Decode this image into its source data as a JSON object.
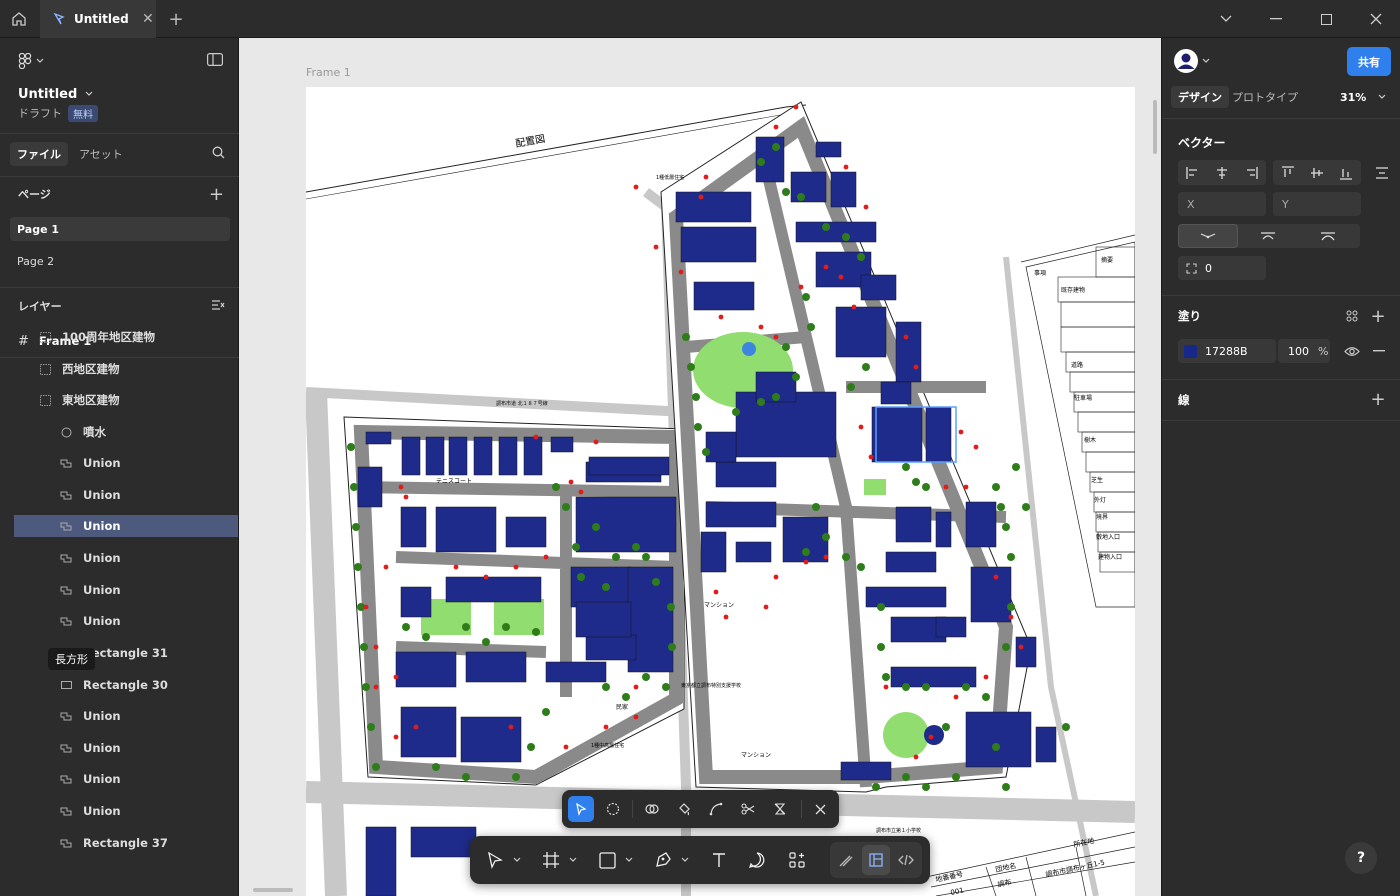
{
  "tab": {
    "title": "Untitled"
  },
  "file": {
    "name": "Untitled",
    "status": "ドラフト",
    "plan_badge": "無料"
  },
  "left_tabs": {
    "file": "ファイル",
    "assets": "アセット"
  },
  "pages": {
    "header": "ページ",
    "items": [
      "Page 1",
      "Page 2"
    ]
  },
  "layers": {
    "header": "レイヤー",
    "frame": "Frame 1",
    "items": [
      {
        "label": "100周年地区建物",
        "icon": "group-icon"
      },
      {
        "label": "西地区建物",
        "icon": "group-icon"
      },
      {
        "label": "東地区建物",
        "icon": "group-icon"
      },
      {
        "label": "噴水",
        "icon": "ellipse-icon"
      },
      {
        "label": "Union",
        "icon": "union-icon"
      },
      {
        "label": "Union",
        "icon": "union-icon"
      },
      {
        "label": "Union",
        "icon": "union-icon"
      },
      {
        "label": "Union",
        "icon": "union-icon"
      },
      {
        "label": "Union",
        "icon": "union-icon"
      },
      {
        "label": "Union",
        "icon": "union-icon"
      },
      {
        "label": "Rectangle 31",
        "icon": "rectangle-icon"
      },
      {
        "label": "Rectangle 30",
        "icon": "rectangle-icon"
      },
      {
        "label": "Union",
        "icon": "union-icon"
      },
      {
        "label": "Union",
        "icon": "union-icon"
      },
      {
        "label": "Union",
        "icon": "union-icon"
      },
      {
        "label": "Union",
        "icon": "union-icon"
      },
      {
        "label": "Rectangle 37",
        "icon": "union-icon"
      }
    ],
    "tooltip": "長方形"
  },
  "canvas": {
    "frame_label": "Frame 1",
    "map_title": "配置図",
    "labels": [
      "テニスコート",
      "マンション",
      "マンション",
      "民家",
      "東京都立調布特別支援学校",
      "1種中高層住宅",
      "1種低層住宅",
      "調布市道 北１８７号線",
      "調布市立第１小学校"
    ],
    "table_labels": [
      "事項",
      "摘要",
      "既存建物",
      "道路",
      "駐車場",
      "樹木",
      "芝生",
      "外灯",
      "境界",
      "敷地入口",
      "建物入口",
      "地番番号",
      "団地名",
      "所在地",
      "001",
      "調布",
      "調布市調布ヶ丘1-5"
    ]
  },
  "right": {
    "share": "共有",
    "tabs": {
      "design": "デザイン",
      "prototype": "プロトタイプ"
    },
    "zoom": "31%",
    "section_title": "ベクター",
    "x_label": "X",
    "y_label": "Y",
    "radius": "0",
    "fill_header": "塗り",
    "fill_hex": "17288B",
    "fill_opacity": "100",
    "fill_percent": "%",
    "stroke_header": "線",
    "fill_color": "#17288b"
  },
  "help": "?"
}
